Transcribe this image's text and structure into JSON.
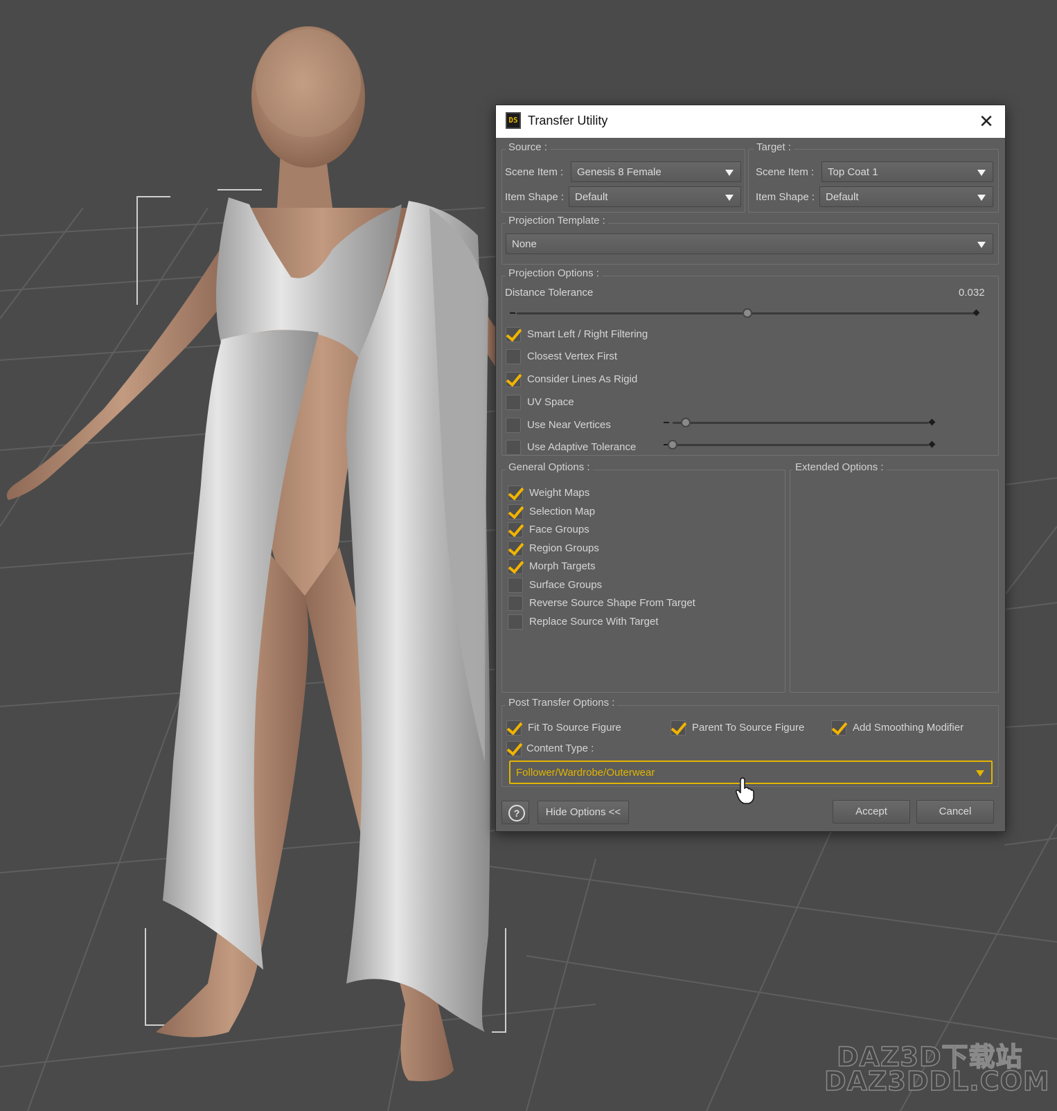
{
  "dialog": {
    "title": "Transfer Utility",
    "icon_text": "DS",
    "close_glyph": "✕",
    "source": {
      "group_title": "Source :",
      "scene_item_label": "Scene Item :",
      "scene_item_value": "Genesis 8 Female",
      "item_shape_label": "Item Shape :",
      "item_shape_value": "Default"
    },
    "target": {
      "group_title": "Target :",
      "scene_item_label": "Scene Item :",
      "scene_item_value": "Top Coat 1",
      "item_shape_label": "Item Shape :",
      "item_shape_value": "Default"
    },
    "projection_template": {
      "group_title": "Projection Template :",
      "value": "None"
    },
    "projection_options": {
      "group_title": "Projection Options :",
      "distance_tolerance_label": "Distance Tolerance",
      "distance_tolerance_value": "0.032",
      "distance_tolerance_slider_fraction": 0.5,
      "options": [
        {
          "label": "Smart Left / Right Filtering",
          "checked": true
        },
        {
          "label": "Closest Vertex First",
          "checked": false
        },
        {
          "label": "Consider Lines As Rigid",
          "checked": true
        },
        {
          "label": "UV Space",
          "checked": false
        },
        {
          "label": "Use Near Vertices",
          "checked": false
        },
        {
          "label": "Use Adaptive Tolerance",
          "checked": false
        }
      ],
      "near_vertices_slider_fraction": 0.05,
      "adaptive_tolerance_slider_fraction": 0.0
    },
    "general_options": {
      "group_title": "General Options :",
      "options": [
        {
          "label": "Weight Maps",
          "checked": true
        },
        {
          "label": "Selection Map",
          "checked": true
        },
        {
          "label": "Face Groups",
          "checked": true
        },
        {
          "label": "Region Groups",
          "checked": true
        },
        {
          "label": "Morph Targets",
          "checked": true
        },
        {
          "label": "Surface Groups",
          "checked": false
        },
        {
          "label": "Reverse Source Shape From Target",
          "checked": false
        },
        {
          "label": "Replace Source With Target",
          "checked": false
        }
      ]
    },
    "extended_options": {
      "group_title": "Extended Options :"
    },
    "post_transfer_options": {
      "group_title": "Post Transfer Options :",
      "fit_to_source": {
        "label": "Fit To Source Figure",
        "checked": true
      },
      "parent_to_source": {
        "label": "Parent To Source Figure",
        "checked": true
      },
      "add_smoothing": {
        "label": "Add Smoothing Modifier",
        "checked": true
      },
      "content_type": {
        "label": "Content Type :",
        "checked": true
      },
      "content_type_value": "Follower/Wardrobe/Outerwear"
    },
    "footer": {
      "help_glyph": "?",
      "hide_options_label": "Hide Options <<",
      "accept_label": "Accept",
      "cancel_label": "Cancel"
    },
    "accent_color": "#e2b400"
  },
  "viewport": {
    "background_color": "#4a4a4a",
    "grid_color": "#5c5c5c",
    "figure_skin_color": "#b78e75",
    "garment_color": "#c9c9c9"
  },
  "watermark": {
    "line1": "DAZ3D下载站",
    "line2": "DAZ3DDL.COM"
  }
}
